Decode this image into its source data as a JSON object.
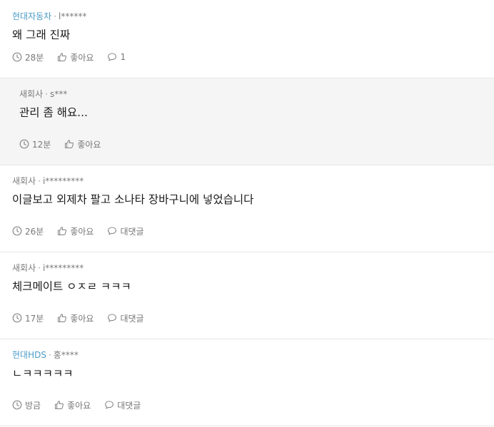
{
  "comments": [
    {
      "company": "현대자동차",
      "user": "l******",
      "text": "왜 그래 진짜",
      "time": "28분",
      "like": "좋아요",
      "reply": "1"
    },
    {
      "company": "새회사",
      "user": "s***",
      "text": "관리 좀 해요...",
      "time": "12분",
      "like": "좋아요"
    },
    {
      "company": "새회사",
      "user": "i*********",
      "text": "이글보고 외제차 팔고 소나타 장바구니에 넣었습니다",
      "time": "26분",
      "like": "좋아요",
      "reply": "대댓글"
    },
    {
      "company": "새회사",
      "user": "i*********",
      "text": "체크메이트 ㅇㅈㄹ ㅋㅋㅋ",
      "time": "17분",
      "like": "좋아요",
      "reply": "대댓글"
    },
    {
      "company": "현대HDS",
      "user": "홍****",
      "text": "ㄴㅋㅋㅋㅋㅋ",
      "time": "방금",
      "like": "좋아요",
      "reply": "대댓글"
    }
  ],
  "separator": "·",
  "colors": {
    "company_link": "#4a9bc7",
    "reply_bg": "#f5f5f5",
    "meta": "#7a7a7a"
  },
  "icons": {
    "time": "clock-icon",
    "like": "thumbs-up-icon",
    "reply": "speech-bubble-icon"
  }
}
